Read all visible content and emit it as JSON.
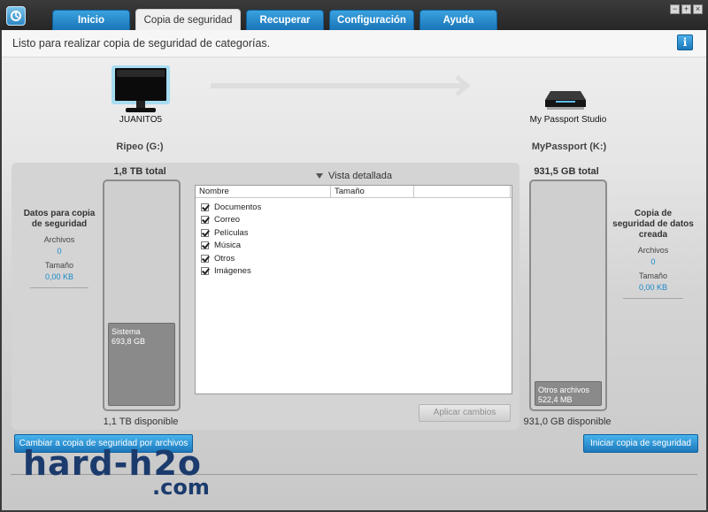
{
  "tabs": [
    {
      "label": "Inicio"
    },
    {
      "label": "Copia de seguridad"
    },
    {
      "label": "Recuperar"
    },
    {
      "label": "Configuración"
    },
    {
      "label": "Ayuda"
    }
  ],
  "window_buttons": {
    "minimize": "−",
    "maximize": "+",
    "close": "×"
  },
  "status": {
    "text": "Listo para realizar copia de seguridad de categorías.",
    "info_glyph": "i"
  },
  "source": {
    "computer_name": "JUANITO5",
    "drive_name": "Ripeo (G:)",
    "total": "1,8 TB total",
    "available": "1,1 TB disponible",
    "segment": {
      "name": "Sistema",
      "size": "693,8 GB"
    },
    "used_fraction": 0.377,
    "stats": {
      "title": "Datos para copia de seguridad",
      "files_label": "Archivos",
      "files_value": "0",
      "size_label": "Tamaño",
      "size_value": "0,00 KB"
    }
  },
  "target": {
    "device_name": "My Passport Studio",
    "drive_name": "MyPassport (K:)",
    "total": "931,5 GB total",
    "available": "931,0 GB disponible",
    "segment": {
      "name": "Otros archivos",
      "size": "522,4 MB"
    },
    "used_fraction": 0.1,
    "stats": {
      "title": "Copia de seguridad de datos creada",
      "files_label": "Archivos",
      "files_value": "0",
      "size_label": "Tamaño",
      "size_value": "0,00 KB"
    }
  },
  "view": {
    "toggle_label": "Vista detallada",
    "columns": [
      "Nombre",
      "Tamaño",
      ""
    ],
    "categories": [
      {
        "label": "Documentos",
        "checked": true
      },
      {
        "label": "Correo",
        "checked": true
      },
      {
        "label": "Películas",
        "checked": true
      },
      {
        "label": "Música",
        "checked": true
      },
      {
        "label": "Otros",
        "checked": true
      },
      {
        "label": "Imágenes",
        "checked": true
      }
    ],
    "apply_label": "Aplicar cambios"
  },
  "buttons": {
    "file_backup": "Cambiar a copia de seguridad por archivos",
    "start_backup": "Iniciar copia de seguridad"
  },
  "watermark": {
    "line1": "hard-h2o",
    "line2": ".com"
  },
  "colors": {
    "accent": "#1f84c8",
    "value_text": "#1a88c9",
    "watermark": "#1c3b6d"
  }
}
